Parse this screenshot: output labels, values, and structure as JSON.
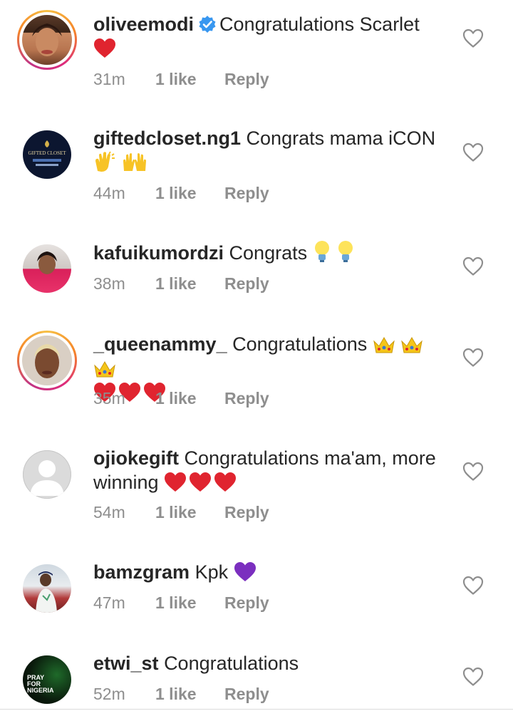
{
  "comments": [
    {
      "username": "oliveemodi",
      "verified": true,
      "text": "Congratulations Scarlet",
      "emojis": [
        "heart"
      ],
      "time": "31m",
      "likes": "1 like",
      "reply": "Reply",
      "avatar": "photo-woman",
      "story_ring": true
    },
    {
      "username": "giftedcloset.ng1",
      "verified": false,
      "text": "Congrats mama iCON",
      "emojis": [
        "clapping-hands",
        "raising-hands"
      ],
      "time": "44m",
      "likes": "1 like",
      "reply": "Reply",
      "avatar": "brand-logo",
      "story_ring": false
    },
    {
      "username": "kafuikumordzi",
      "verified": false,
      "text": "Congrats",
      "emojis": [
        "light-bulb",
        "light-bulb"
      ],
      "time": "38m",
      "likes": "1 like",
      "reply": "Reply",
      "avatar": "photo-woman-pink",
      "story_ring": false
    },
    {
      "username": "_queenammy_",
      "verified": false,
      "text": "Congratulations",
      "emojis": [
        "crown",
        "crown",
        "crown",
        "heart",
        "heart",
        "heart"
      ],
      "time": "35m",
      "likes": "1 like",
      "reply": "Reply",
      "avatar": "photo-woman-blonde",
      "story_ring": true
    },
    {
      "username": "ojiokegift",
      "verified": false,
      "text": "Congratulations ma'am, more winning",
      "emojis": [
        "heart",
        "heart",
        "heart"
      ],
      "time": "54m",
      "likes": "1 like",
      "reply": "Reply",
      "avatar": "default-avatar",
      "story_ring": false
    },
    {
      "username": "bamzgram",
      "verified": false,
      "text": "Kpk",
      "emojis": [
        "purple-heart"
      ],
      "time": "47m",
      "likes": "1 like",
      "reply": "Reply",
      "avatar": "photo-man",
      "story_ring": false
    },
    {
      "username": "etwi_st",
      "verified": false,
      "text": "Congratulations",
      "emojis": [],
      "time": "52m",
      "likes": "1 like",
      "reply": "Reply",
      "avatar": "pray-for-nigeria",
      "story_ring": false
    }
  ],
  "avatar_texts": {
    "giftedcloset": "GIFTED CLOSET",
    "pray_for_nigeria": [
      "PRAY",
      "FOR",
      "NIGERIA"
    ]
  },
  "colors": {
    "heart": "#e0242f",
    "purple_heart": "#7b2fbf",
    "verified": "#3897f0",
    "meta": "#8e8e8e",
    "text": "#262626",
    "crown": "#f5c518"
  }
}
